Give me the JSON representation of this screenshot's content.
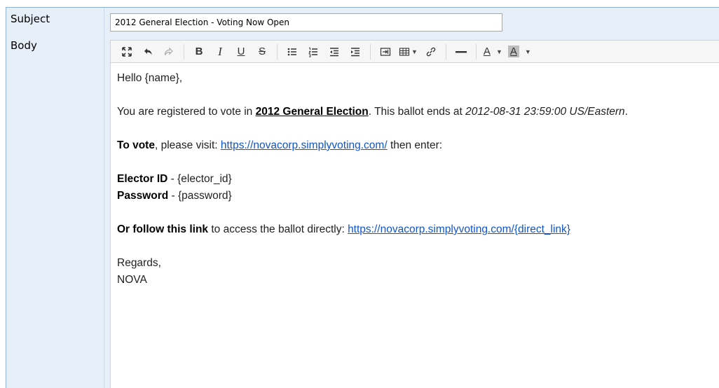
{
  "subject": {
    "label": "Subject",
    "value": "2012 General Election - Voting Now Open"
  },
  "body": {
    "label": "Body"
  },
  "toolbar": {
    "buttons": [
      {
        "name": "maximize-icon",
        "glyph": "⛶"
      },
      {
        "name": "undo-icon",
        "glyph": "↶"
      },
      {
        "name": "redo-icon",
        "glyph": "↷"
      },
      {
        "name": "bold-icon",
        "glyph": "B"
      },
      {
        "name": "italic-icon",
        "glyph": "I"
      },
      {
        "name": "underline-icon",
        "glyph": "U"
      },
      {
        "name": "strikethrough-icon",
        "glyph": "S"
      },
      {
        "name": "bulleted-list-icon"
      },
      {
        "name": "numbered-list-icon"
      },
      {
        "name": "outdent-icon"
      },
      {
        "name": "indent-icon"
      },
      {
        "name": "insert-template-icon"
      },
      {
        "name": "table-icon"
      },
      {
        "name": "link-icon"
      },
      {
        "name": "horizontal-rule-icon"
      },
      {
        "name": "text-color-icon",
        "glyph": "A"
      },
      {
        "name": "background-color-icon",
        "glyph": "A"
      }
    ]
  },
  "email": {
    "greeting": "Hello {name},",
    "registered_prefix": "You are registered to vote in ",
    "election_name": "2012 General Election",
    "registered_mid": ". This ballot ends at ",
    "end_datetime": "2012-08-31 23:59:00 US/Eastern",
    "registered_suffix": ".",
    "to_vote_bold": "To vote",
    "to_vote_text": ", please visit: ",
    "vote_url": "https://novacorp.simplyvoting.com/",
    "then_enter": " then enter:",
    "elector_id_label": "Elector ID",
    "elector_id_value": " - {elector_id}",
    "password_label": "Password",
    "password_value": " - {password}",
    "follow_bold": "Or follow this link",
    "follow_text": " to access the ballot directly: ",
    "direct_url": "https://novacorp.simplyvoting.com/{direct_link}",
    "regards": "Regards,",
    "signature": "NOVA"
  },
  "colors": {
    "label_background": "#e6eef7",
    "frame_border": "#8fb2d6",
    "link": "#1155cc"
  }
}
